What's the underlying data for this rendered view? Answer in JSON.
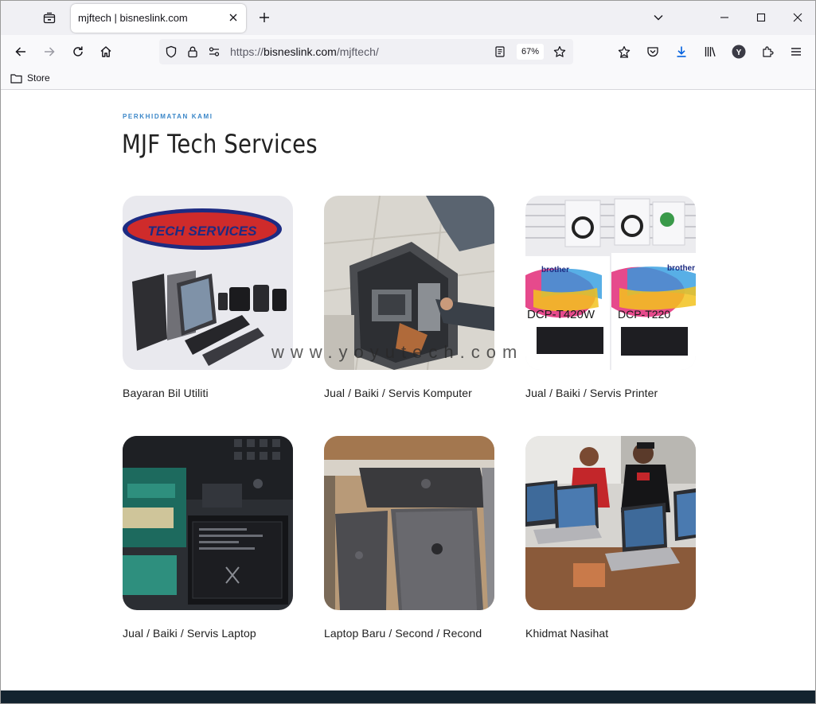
{
  "browser": {
    "tab": {
      "title": "mjftech | bisneslink.com"
    },
    "url": {
      "scheme": "https://",
      "host": "bisneslink.com",
      "path": "/mjftech/"
    },
    "zoom": "67%",
    "bookmarks": [
      {
        "label": "Store"
      }
    ]
  },
  "page": {
    "eyebrow": "PERKHIDMATAN KAMI",
    "title": "MJF Tech Services",
    "watermark": "www.yoyutech.com",
    "cards": [
      {
        "label": "Bayaran Bil Utiliti",
        "logo_text": "TECH SERVICES"
      },
      {
        "label": "Jual / Baiki / Servis Komputer"
      },
      {
        "label": "Jual / Baiki / Servis Printer",
        "box_labels": [
          "DCP-T420W",
          "DCP-T220"
        ],
        "box_brand": "brother"
      },
      {
        "label": "Jual / Baiki / Servis Laptop"
      },
      {
        "label": "Laptop Baru / Second / Recond"
      },
      {
        "label": "Khidmat Nasihat"
      }
    ]
  },
  "colors": {
    "accent": "#3a86c8",
    "footer": "#13232f",
    "icon_blue": "#0060df"
  },
  "icons": [
    "tab-list-icon",
    "close-icon",
    "plus-icon",
    "chevron-down-icon",
    "minimize-icon",
    "maximize-icon",
    "back-icon",
    "forward-icon",
    "reload-icon",
    "home-icon",
    "shield-icon",
    "lock-icon",
    "permissions-icon",
    "reader-view-icon",
    "star-icon",
    "save-to-collection-icon",
    "pocket-icon",
    "download-icon",
    "library-icon",
    "account-icon",
    "extensions-icon",
    "menu-icon",
    "folder-icon"
  ]
}
